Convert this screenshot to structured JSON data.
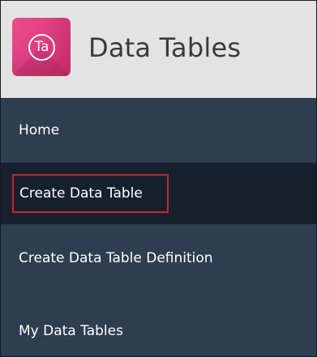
{
  "header": {
    "logo_text": "Ta",
    "title": "Data Tables",
    "logo_color": "#e0407f"
  },
  "nav": {
    "items": [
      {
        "label": "Home",
        "active": false
      },
      {
        "label": "Create Data Table",
        "active": true,
        "highlighted": true
      },
      {
        "label": "Create Data Table Definition",
        "active": false
      },
      {
        "label": "My Data Tables",
        "active": false
      }
    ],
    "background_color": "#2e3d4f",
    "active_color": "#17212d",
    "highlight_color": "#c8242c"
  }
}
